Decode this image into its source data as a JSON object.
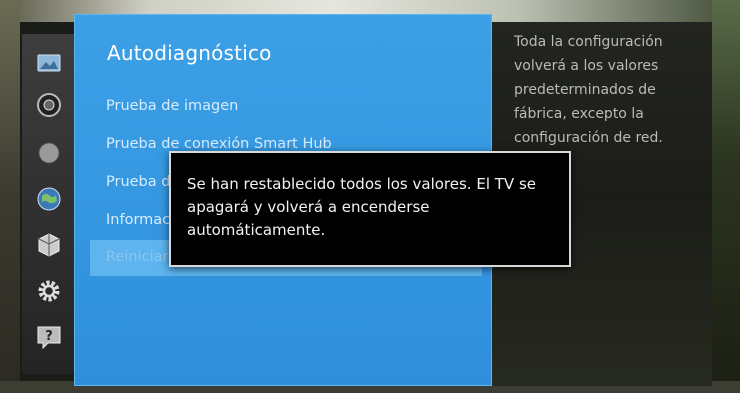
{
  "menu": {
    "title": "Autodiagnóstico",
    "items": [
      {
        "label": "Prueba de imagen"
      },
      {
        "label": "Prueba de conexión Smart Hub"
      },
      {
        "label": "Prueba de sonido"
      },
      {
        "label": "Información de señal"
      },
      {
        "label": "Reiniciar"
      }
    ]
  },
  "description": {
    "lines": [
      "Toda la configuración",
      "volverá a los valores",
      "predeterminados de",
      "fábrica, excepto la",
      "configuración de red."
    ]
  },
  "popup": {
    "lines": [
      "Se han restablecido todos los valores. El TV se",
      "apagará y volverá a encenderse",
      "automáticamente."
    ]
  },
  "nav_icons": [
    "picture-icon",
    "sound-icon",
    "broadcast-icon",
    "network-icon",
    "smart-hub-icon",
    "settings-icon",
    "support-icon"
  ],
  "colors": {
    "panel_blue": "#3ca0e6",
    "popup_bg": "#000000",
    "popup_border": "#d8d8d8"
  }
}
